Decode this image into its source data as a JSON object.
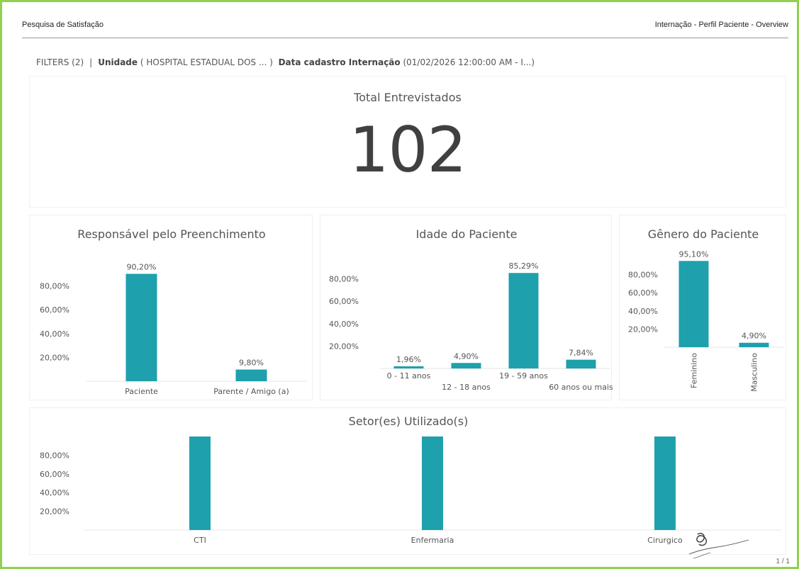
{
  "header": {
    "left_title": "Pesquisa de Satisfação",
    "right_title": "Internação - Perfil Paciente - Overview"
  },
  "filters": {
    "label": "FILTERS (2)",
    "separator": "|",
    "f1_name": "Unidade",
    "f1_value": "( HOSPITAL ESTADUAL DOS ... )",
    "f2_name": "Data cadastro Internação",
    "f2_value": "(01/02/2026 12:00:00 AM - I...)"
  },
  "kpi": {
    "title": "Total Entrevistados",
    "value": "102"
  },
  "colors": {
    "bar": "#1ea0ad",
    "axis_text": "#555555",
    "grid": "#eeeeee"
  },
  "chart_data": [
    {
      "type": "bar",
      "title": "Responsável pelo Preenchimento",
      "categories": [
        "Paciente",
        "Parente / Amigo (a)"
      ],
      "values": [
        90.2,
        9.8
      ],
      "data_labels": [
        "90,20%",
        "9,80%"
      ],
      "yticks": [
        "20,00%",
        "40,00%",
        "60,00%",
        "80,00%"
      ],
      "ylim": [
        0,
        100
      ],
      "grid": false
    },
    {
      "type": "bar",
      "title": "Idade do Paciente",
      "categories": [
        "0 - 11 anos",
        "12 - 18 anos",
        "19 - 59 anos",
        "60 anos ou mais"
      ],
      "values": [
        1.96,
        4.9,
        85.29,
        7.84
      ],
      "data_labels": [
        "1,96%",
        "4,90%",
        "85,29%",
        "7,84%"
      ],
      "yticks": [
        "20,00%",
        "40,00%",
        "60,00%",
        "80,00%"
      ],
      "ylim": [
        0,
        100
      ],
      "grid": false
    },
    {
      "type": "bar",
      "title": "Gênero do Paciente",
      "categories": [
        "Feminino",
        "Masculino"
      ],
      "values": [
        95.1,
        4.9
      ],
      "data_labels": [
        "95,10%",
        "4,90%"
      ],
      "yticks": [
        "20,00%",
        "40,00%",
        "60,00%",
        "80,00%"
      ],
      "ylim": [
        0,
        100
      ],
      "grid": false
    },
    {
      "type": "bar",
      "title": "Setor(es) Utilizado(s)",
      "categories": [
        "CTI",
        "Enfermaria",
        "Cirurgico"
      ],
      "values": [
        100,
        100,
        100
      ],
      "yticks": [
        "20,00%",
        "40,00%",
        "60,00%",
        "80,00%"
      ],
      "ylim": [
        0,
        100
      ],
      "grid": false
    }
  ],
  "footer": {
    "page": "1 / 1"
  }
}
